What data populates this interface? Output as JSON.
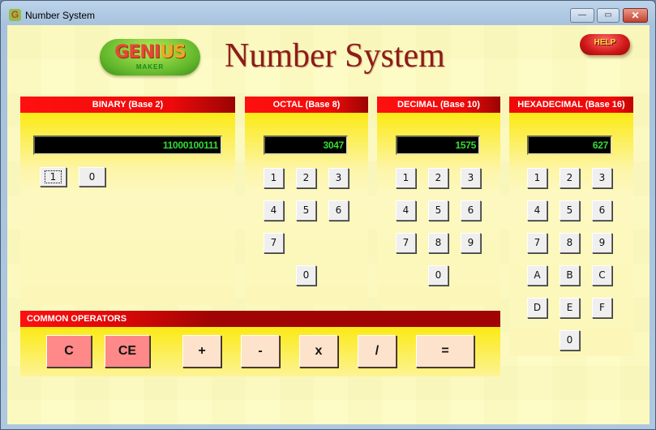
{
  "window": {
    "title": "Number System",
    "icon": "genius-maker-icon",
    "controls": {
      "minimize": "—",
      "maximize": "▭",
      "close": "✕"
    }
  },
  "header": {
    "logo_top_1": "GENI",
    "logo_top_2": "US",
    "logo_bottom": "MAKER",
    "title": "Number System",
    "help_label": "HELP"
  },
  "panels": {
    "binary": {
      "title": "BINARY (Base 2)",
      "value": "11000100111",
      "keys": [
        "1",
        "0"
      ]
    },
    "octal": {
      "title": "OCTAL (Base 8)",
      "value": "3047",
      "keys": [
        "1",
        "2",
        "3",
        "4",
        "5",
        "6",
        "7",
        "0"
      ]
    },
    "decimal": {
      "title": "DECIMAL (Base 10)",
      "value": "1575",
      "keys": [
        "1",
        "2",
        "3",
        "4",
        "5",
        "6",
        "7",
        "8",
        "9",
        "0"
      ]
    },
    "hexadecimal": {
      "title": "HEXADECIMAL (Base 16)",
      "value": "627",
      "keys": [
        "1",
        "2",
        "3",
        "4",
        "5",
        "6",
        "7",
        "8",
        "9",
        "A",
        "B",
        "C",
        "D",
        "E",
        "F",
        "0"
      ]
    }
  },
  "operators": {
    "title": "COMMON OPERATORS",
    "buttons": [
      "C",
      "CE",
      "+",
      "-",
      "x",
      "/",
      "="
    ]
  },
  "colors": {
    "header_red": "#ee0a0a",
    "panel_yellow": "#fbe800",
    "display_text": "#33dd33",
    "clear_button": "#ff8888",
    "operator_button": "#fde2cc",
    "title_text": "#8e1b18"
  }
}
